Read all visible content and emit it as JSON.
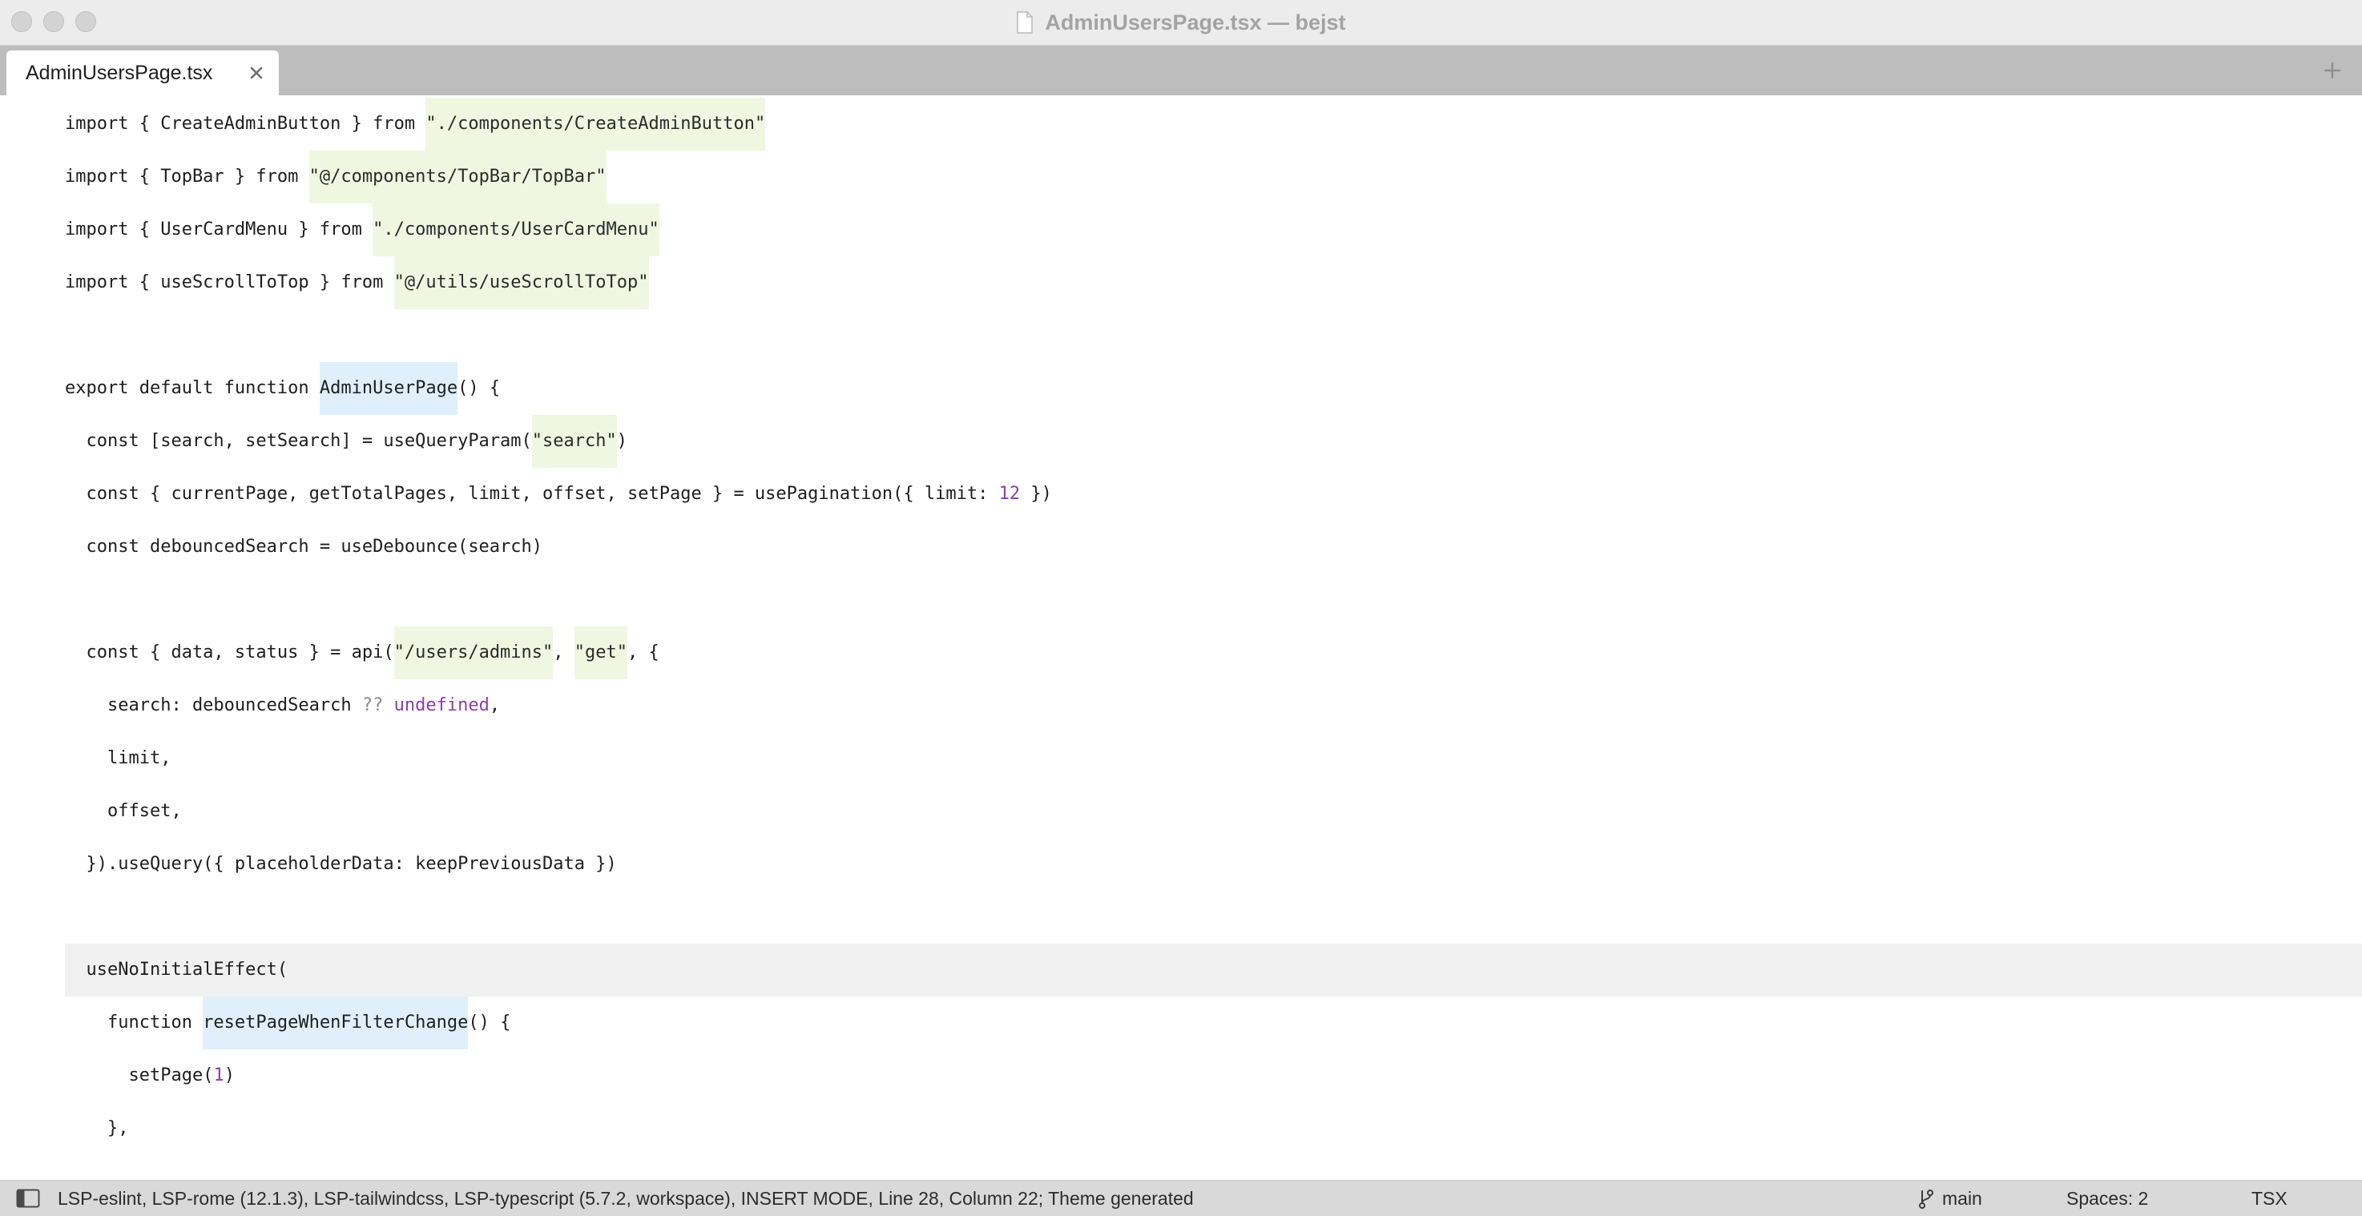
{
  "window": {
    "title": "AdminUsersPage.tsx — bejst"
  },
  "tabs": [
    {
      "label": "AdminUsersPage.tsx",
      "active": true
    }
  ],
  "icons": {
    "close": "close-icon",
    "new_tab": "plus-icon",
    "document": "document-icon",
    "sidebar_toggle": "sidebar-toggle-icon",
    "branch": "git-branch-icon"
  },
  "colors": {
    "string_highlight": "#eff7e1",
    "function_highlight": "#dff0fc",
    "number": "#8c3fa8",
    "current_line": "#f1f1f1",
    "status_bar": "#d9d9d9",
    "tab_bar": "#bdbdbd"
  },
  "editor": {
    "current_line_index": 16,
    "lines": [
      [
        {
          "t": "import { CreateAdminButton } from "
        },
        {
          "t": "\"./components/CreateAdminButton\"",
          "c": "str"
        }
      ],
      [
        {
          "t": "import { TopBar } from "
        },
        {
          "t": "\"@/components/TopBar/TopBar\"",
          "c": "str"
        }
      ],
      [
        {
          "t": "import { UserCardMenu } from "
        },
        {
          "t": "\"./components/UserCardMenu\"",
          "c": "str"
        }
      ],
      [
        {
          "t": "import { useScrollToTop } from "
        },
        {
          "t": "\"@/utils/useScrollToTop\"",
          "c": "str"
        }
      ],
      [],
      [
        {
          "t": "export default function "
        },
        {
          "t": "AdminUserPage",
          "c": "fn"
        },
        {
          "t": "() {"
        }
      ],
      [
        {
          "t": "  const [search, setSearch] = useQueryParam("
        },
        {
          "t": "\"search\"",
          "c": "str"
        },
        {
          "t": ")"
        }
      ],
      [
        {
          "t": "  const { currentPage, getTotalPages, limit, offset, setPage } = usePagination({ limit: "
        },
        {
          "t": "12",
          "c": "num"
        },
        {
          "t": " })"
        }
      ],
      [
        {
          "t": "  const debouncedSearch = useDebounce(search)"
        }
      ],
      [],
      [
        {
          "t": "  const { data, status } = api("
        },
        {
          "t": "\"/users/admins\"",
          "c": "str"
        },
        {
          "t": ", "
        },
        {
          "t": "\"get\"",
          "c": "str"
        },
        {
          "t": ", {"
        }
      ],
      [
        {
          "t": "    search: debouncedSearch "
        },
        {
          "t": "??",
          "c": "op"
        },
        {
          "t": " "
        },
        {
          "t": "undefined",
          "c": "kwp"
        },
        {
          "t": ","
        }
      ],
      [
        {
          "t": "    limit,"
        }
      ],
      [
        {
          "t": "    offset,"
        }
      ],
      [
        {
          "t": "  }).useQuery({ placeholderData: keepPreviousData })"
        }
      ],
      [],
      [
        {
          "t": "  useNoInitialEffect("
        }
      ],
      [
        {
          "t": "    function "
        },
        {
          "t": "resetPageWhenFilterChange",
          "c": "fn"
        },
        {
          "t": "() {"
        }
      ],
      [
        {
          "t": "      setPage("
        },
        {
          "t": "1",
          "c": "num"
        },
        {
          "t": ")"
        }
      ],
      [
        {
          "t": "    },"
        }
      ]
    ]
  },
  "status": {
    "text": "LSP-eslint, LSP-rome (12.1.3), LSP-tailwindcss, LSP-typescript (5.7.2, workspace), INSERT MODE, Line 28, Column 22; Theme generated",
    "branch": "main",
    "spaces": "Spaces: 2",
    "syntax": "TSX"
  }
}
